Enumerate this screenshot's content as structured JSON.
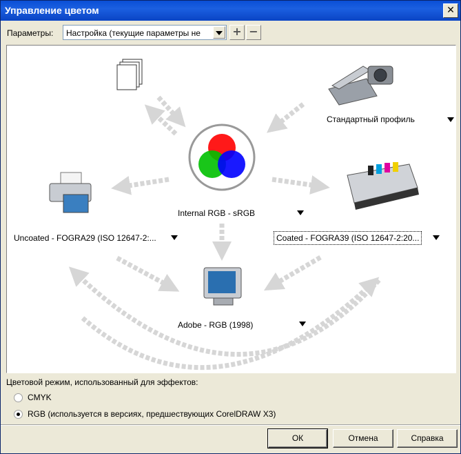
{
  "window": {
    "title": "Управление цветом",
    "close_glyph": "✕"
  },
  "params": {
    "label": "Параметры:",
    "selected": "Настройка (текущие параметры не",
    "add_glyph": "+",
    "remove_glyph": "−"
  },
  "devices": {
    "center_label": "Internal RGB - sRGB",
    "input_label": "Стандартный профиль",
    "printer_label": "Uncoated - FOGRA29 (ISO 12647-2:...",
    "press_label": "Coated - FOGRA39 (ISO 12647-2:20...",
    "monitor_label": "Adobe - RGB (1998)"
  },
  "effects": {
    "label": "Цветовой режим, использованный для эффектов:",
    "options": [
      {
        "label": "CMYK",
        "selected": false
      },
      {
        "label": "RGB (используется в версиях, предшествующих CorelDRAW X3)",
        "selected": true
      }
    ]
  },
  "buttons": {
    "ok": "ОК",
    "cancel": "Отмена",
    "help": "Справка"
  },
  "colors": {
    "titlebar": "#0a4fd6",
    "arrow": "#d6d6d6",
    "red": "#ff0000",
    "green": "#00c000",
    "blue": "#0000ff"
  }
}
